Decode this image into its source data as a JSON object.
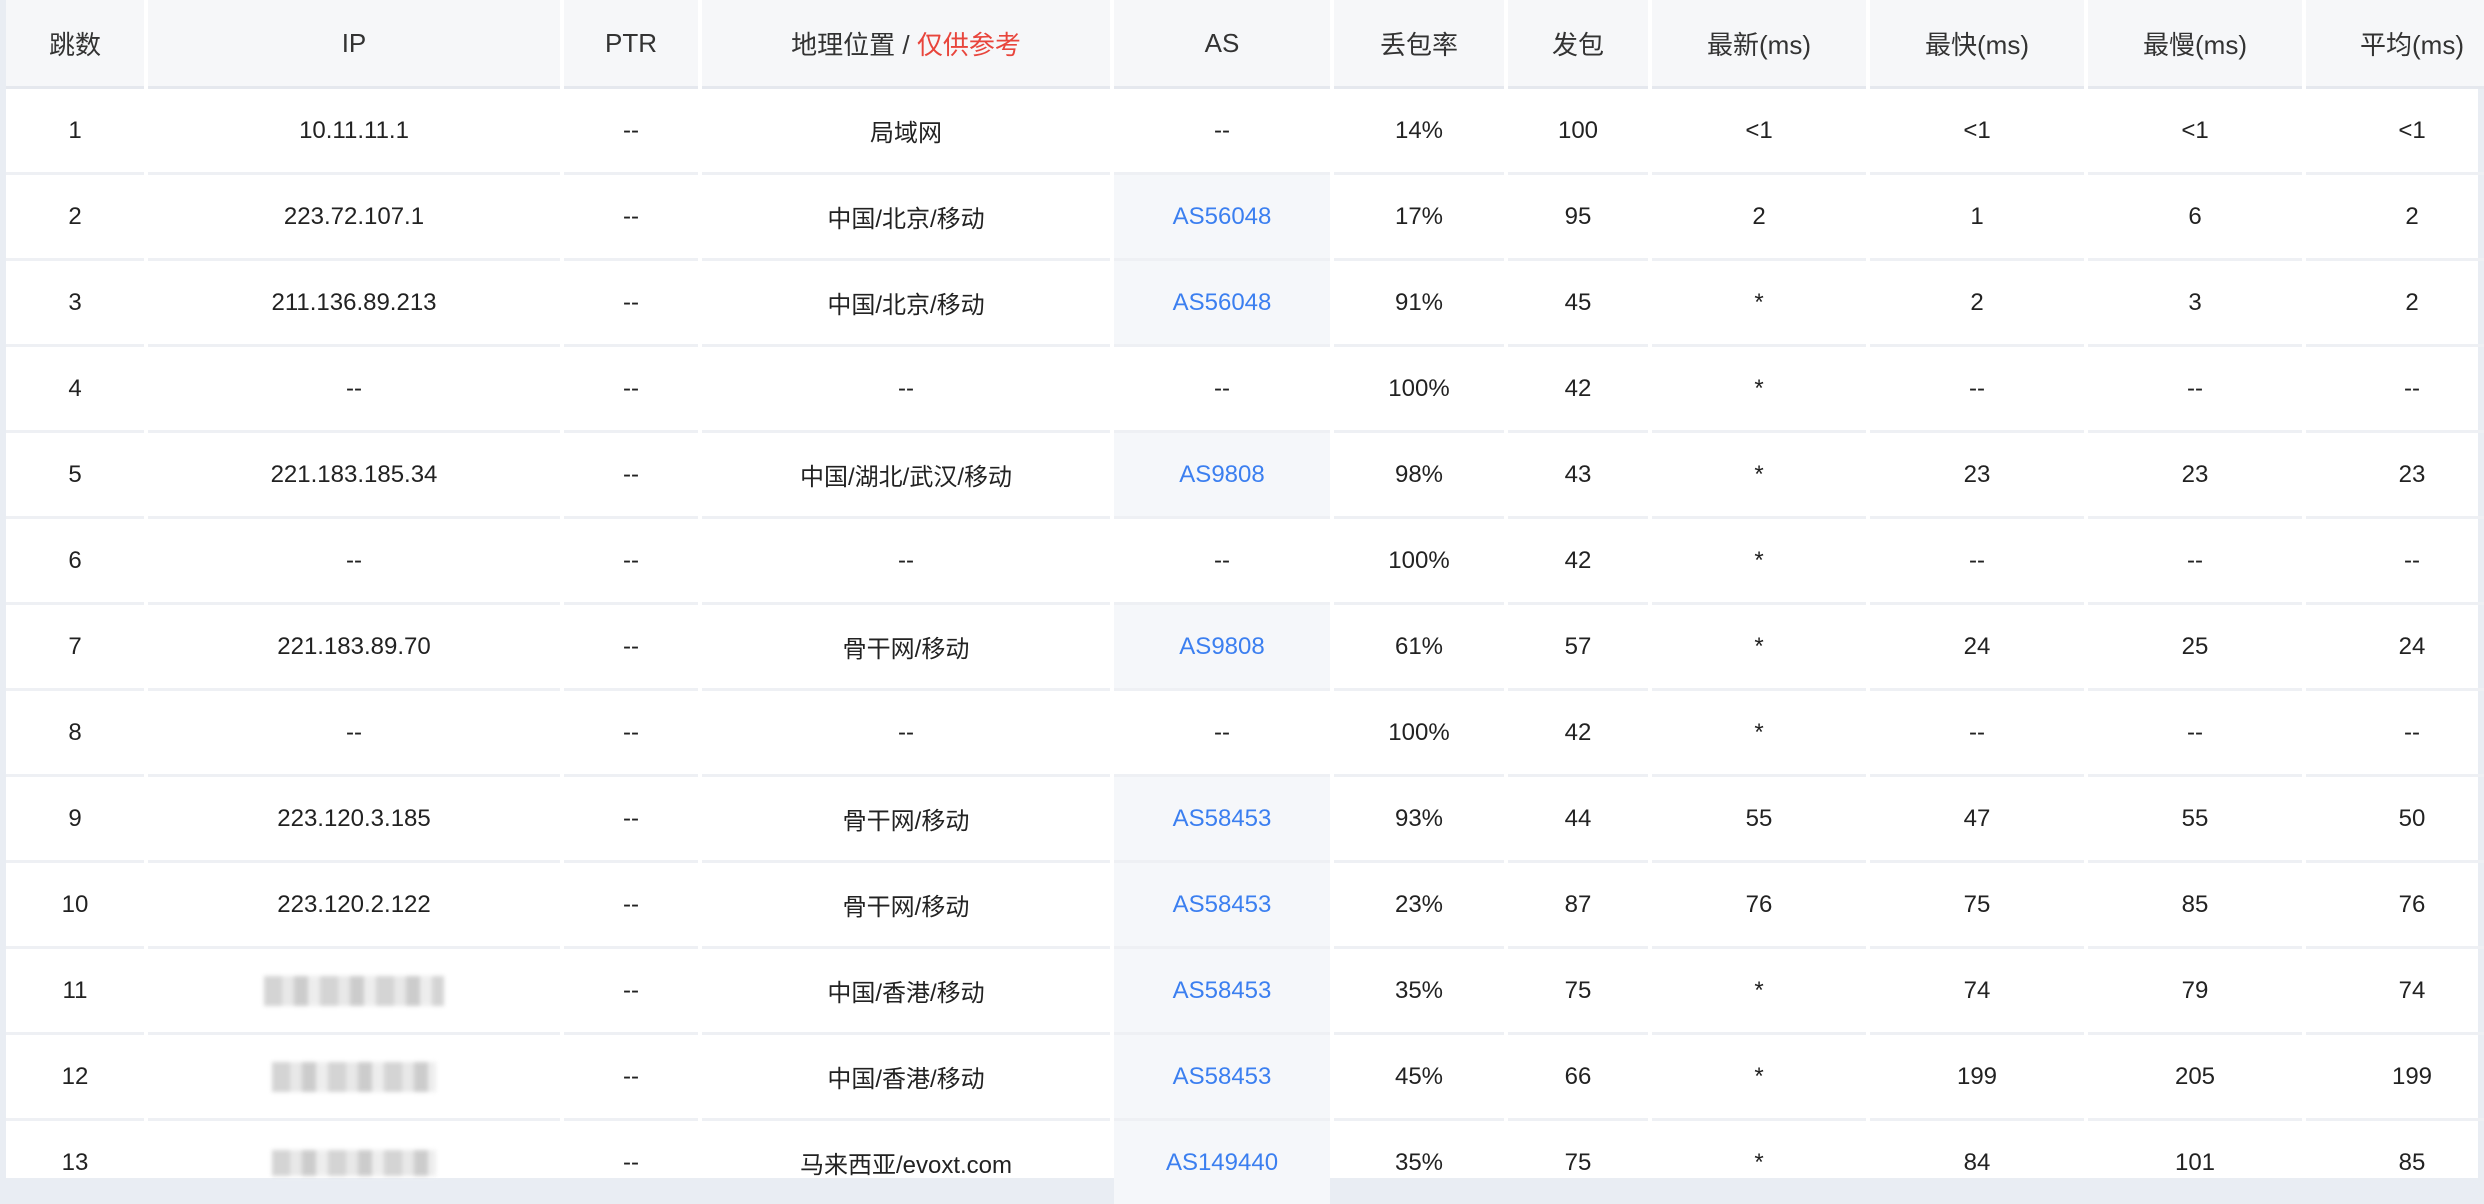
{
  "headers": {
    "hop": "跳数",
    "ip": "IP",
    "ptr": "PTR",
    "geo": "地理位置",
    "geo_sep": " / ",
    "geo_note": "仅供参考",
    "as": "AS",
    "loss": "丢包率",
    "sent": "发包",
    "last": "最新(ms)",
    "best": "最快(ms)",
    "worst": "最慢(ms)",
    "avg": "平均(ms)"
  },
  "rows": [
    {
      "hop": "1",
      "ip": "10.11.11.1",
      "ptr": "--",
      "geo": "局域网",
      "as": "--",
      "loss": "14%",
      "sent": "100",
      "last": "<1",
      "best": "<1",
      "worst": "<1",
      "avg": "<1"
    },
    {
      "hop": "2",
      "ip": "223.72.107.1",
      "ptr": "--",
      "geo": "中国/北京/移动",
      "as": "AS56048",
      "loss": "17%",
      "sent": "95",
      "last": "2",
      "best": "1",
      "worst": "6",
      "avg": "2"
    },
    {
      "hop": "3",
      "ip": "211.136.89.213",
      "ptr": "--",
      "geo": "中国/北京/移动",
      "as": "AS56048",
      "loss": "91%",
      "sent": "45",
      "last": "*",
      "best": "2",
      "worst": "3",
      "avg": "2"
    },
    {
      "hop": "4",
      "ip": "--",
      "ptr": "--",
      "geo": "--",
      "as": "--",
      "loss": "100%",
      "sent": "42",
      "last": "*",
      "best": "--",
      "worst": "--",
      "avg": "--"
    },
    {
      "hop": "5",
      "ip": "221.183.185.34",
      "ptr": "--",
      "geo": "中国/湖北/武汉/移动",
      "as": "AS9808",
      "loss": "98%",
      "sent": "43",
      "last": "*",
      "best": "23",
      "worst": "23",
      "avg": "23"
    },
    {
      "hop": "6",
      "ip": "--",
      "ptr": "--",
      "geo": "--",
      "as": "--",
      "loss": "100%",
      "sent": "42",
      "last": "*",
      "best": "--",
      "worst": "--",
      "avg": "--"
    },
    {
      "hop": "7",
      "ip": "221.183.89.70",
      "ptr": "--",
      "geo": "骨干网/移动",
      "as": "AS9808",
      "loss": "61%",
      "sent": "57",
      "last": "*",
      "best": "24",
      "worst": "25",
      "avg": "24"
    },
    {
      "hop": "8",
      "ip": "--",
      "ptr": "--",
      "geo": "--",
      "as": "--",
      "loss": "100%",
      "sent": "42",
      "last": "*",
      "best": "--",
      "worst": "--",
      "avg": "--"
    },
    {
      "hop": "9",
      "ip": "223.120.3.185",
      "ptr": "--",
      "geo": "骨干网/移动",
      "as": "AS58453",
      "loss": "93%",
      "sent": "44",
      "last": "55",
      "best": "47",
      "worst": "55",
      "avg": "50"
    },
    {
      "hop": "10",
      "ip": "223.120.2.122",
      "ptr": "--",
      "geo": "骨干网/移动",
      "as": "AS58453",
      "loss": "23%",
      "sent": "87",
      "last": "76",
      "best": "75",
      "worst": "85",
      "avg": "76"
    },
    {
      "hop": "11",
      "ip": "",
      "ip_redacted": "w1",
      "ptr": "--",
      "geo": "中国/香港/移动",
      "as": "AS58453",
      "loss": "35%",
      "sent": "75",
      "last": "*",
      "best": "74",
      "worst": "79",
      "avg": "74"
    },
    {
      "hop": "12",
      "ip": "",
      "ip_redacted": "w2",
      "ptr": "--",
      "geo": "中国/香港/移动",
      "as": "AS58453",
      "loss": "45%",
      "sent": "66",
      "last": "*",
      "best": "199",
      "worst": "205",
      "avg": "199"
    },
    {
      "hop": "13",
      "ip": "",
      "ip_redacted": "w3",
      "ptr": "--",
      "geo": "马来西亚/evoxt.com",
      "as": "AS149440",
      "loss": "35%",
      "sent": "75",
      "last": "*",
      "best": "84",
      "worst": "101",
      "avg": "85"
    }
  ]
}
